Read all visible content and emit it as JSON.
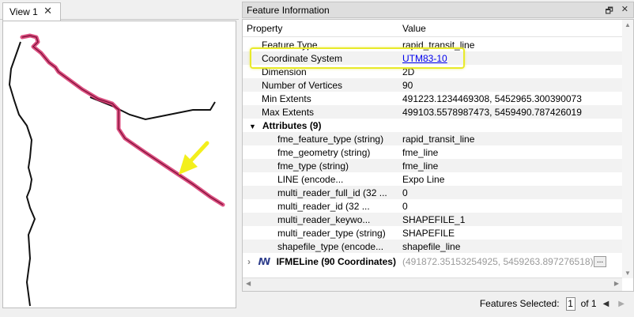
{
  "view": {
    "tab_label": "View 1",
    "close_glyph": "✕"
  },
  "panel": {
    "title": "Feature Information",
    "restore_glyph": "🗗",
    "close_glyph": "✕"
  },
  "table": {
    "col_property": "Property",
    "col_value": "Value",
    "rows": [
      {
        "prop": "Feature Type",
        "value": "rapid_transit_line"
      },
      {
        "prop": "Coordinate System",
        "value": "UTM83-10",
        "link": true
      },
      {
        "prop": "Dimension",
        "value": "2D"
      },
      {
        "prop": "Number of Vertices",
        "value": "90"
      },
      {
        "prop": "Min Extents",
        "value": "491223.1234469308, 5452965.300390073"
      },
      {
        "prop": "Max Extents",
        "value": "499103.5578987473, 5459490.787426019"
      },
      {
        "prop": "Attributes (9)",
        "value": ""
      },
      {
        "prop": "fme_feature_type (string)",
        "value": "rapid_transit_line"
      },
      {
        "prop": "fme_geometry (string)",
        "value": "fme_line"
      },
      {
        "prop": "fme_type (string)",
        "value": "fme_line"
      },
      {
        "prop": "LINE (encode...",
        "value": "Expo Line"
      },
      {
        "prop": "multi_reader_full_id (32 ...",
        "value": "0"
      },
      {
        "prop": "multi_reader_id (32 ...",
        "value": "0"
      },
      {
        "prop": "multi_reader_keywo...",
        "value": "SHAPEFILE_1"
      },
      {
        "prop": "multi_reader_type (string)",
        "value": "SHAPEFILE"
      },
      {
        "prop": "shapefile_type (encode...",
        "value": "shapefile_line"
      },
      {
        "prop": "IFMELine (90 Coordinates)",
        "value": "(491872.35153254925, 5459263.897276518), ..."
      }
    ],
    "more_label": "..."
  },
  "icons": {
    "collapse": "▼",
    "expand": "›",
    "geometry": "ꟿ"
  },
  "status": {
    "features_selected_label": "Features Selected:",
    "page_value": "1",
    "of_label": "of 1"
  },
  "colors": {
    "highlight_line": "#d6336c",
    "highlight_box": "#e8ea2a",
    "arrow": "#f3ef1c",
    "link": "#0000ee"
  }
}
